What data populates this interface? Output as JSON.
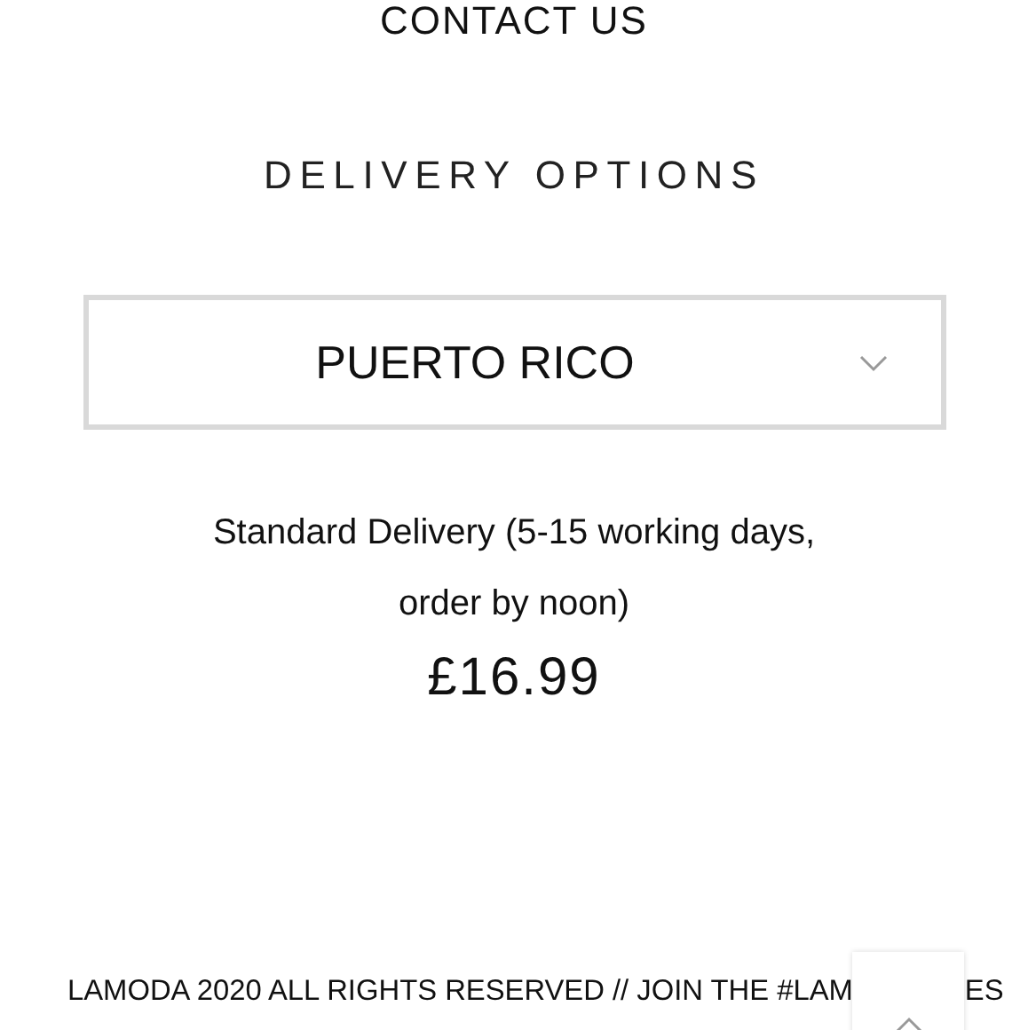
{
  "contact_heading": "CONTACT US",
  "delivery_heading": "DELIVERY OPTIONS",
  "country_select": {
    "value": "PUERTO RICO"
  },
  "delivery_option": {
    "description": "Standard Delivery (5-15 working days, order by noon)",
    "price": "£16.99"
  },
  "footer": {
    "text_before": "LAMODA 2020 ALL RIGHTS RESERVED // JOIN THE #LAM",
    "text_after": "ES"
  }
}
